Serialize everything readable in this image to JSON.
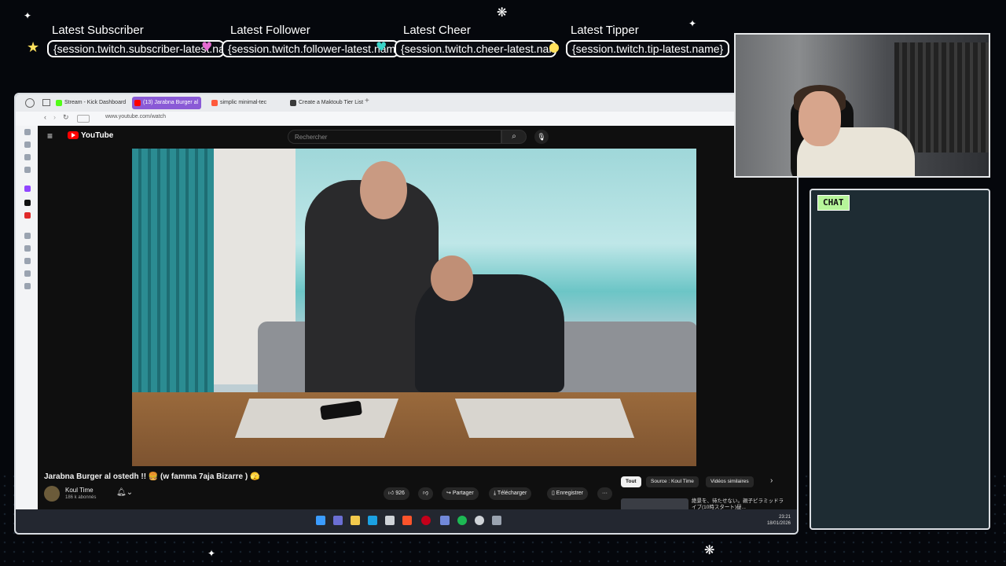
{
  "overlay": {
    "stats": [
      {
        "title": "Latest Subscriber",
        "value": "{session.twitch.subscriber-latest.name}"
      },
      {
        "title": "Latest Follower",
        "value": "{session.twitch.follower-latest.name}"
      },
      {
        "title": "Latest Cheer",
        "value": "{session.twitch.cheer-latest.name}"
      },
      {
        "title": "Latest Tipper",
        "value": "{session.twitch.tip-latest.name}"
      }
    ],
    "chat_label": "CHAT",
    "colors": {
      "accent_green": "#b6f59a",
      "pink": "#e56bd1",
      "teal": "#39d3c8",
      "yellow": "#ffe05c"
    }
  },
  "browser": {
    "tabs": [
      {
        "label": "Stream - Kick Dashboard"
      },
      {
        "label": "(13) Jarabna Burger al"
      },
      {
        "label": "simplic minimal-tec"
      },
      {
        "label": "Create a Maktoub Tier List"
      }
    ],
    "url": "www.youtube.com/watch"
  },
  "youtube": {
    "logo": "YouTube",
    "search_placeholder": "Rechercher",
    "video_title": "Jarabna Burger al ostedh !! 🍔 (w famma 7aja Bizarre ) 🫣",
    "channel": {
      "name": "Koul Time",
      "subs": "186 k abonnés"
    },
    "actions": {
      "likes": "926",
      "share": "Partager",
      "download": "Télécharger",
      "save": "Enregistrer",
      "more": "···"
    },
    "chips": [
      "Tout",
      "Source : Koul Time",
      "Vidéos similaires"
    ],
    "rec_title": "絶景を、待たせない。親子ピラミッドライブ(10時スタート)昼..."
  },
  "taskbar": {
    "time": "23:21",
    "date": "18/01/2026"
  }
}
